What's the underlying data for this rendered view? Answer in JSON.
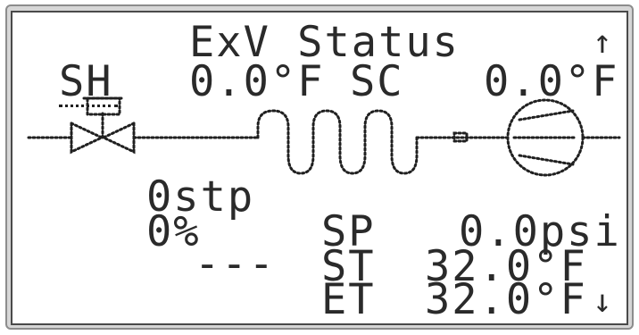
{
  "screen": {
    "title": "ExV Status",
    "scroll_up_symbol": "↑",
    "scroll_down_symbol": "↓",
    "sh_label": "SH",
    "sh_value": "0.0°F",
    "sc_label": "SC",
    "sc_value": "0.0°F",
    "valve_steps": "0stp",
    "valve_percent": "0%",
    "valve_status_dash": "---",
    "sp_label": "SP",
    "sp_value": "0.0psi",
    "st_label": "ST",
    "st_value": "32.0°F",
    "et_label": "ET",
    "et_value": "32.0°F"
  },
  "colors": {
    "lcd_pixel": "#202020",
    "lcd_background": "#ffffff",
    "bezel": "#d6d6d6"
  }
}
